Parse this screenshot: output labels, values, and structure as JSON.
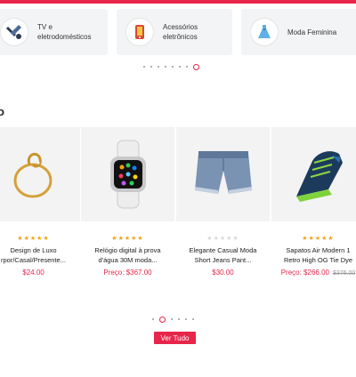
{
  "categories": [
    {
      "label_line1": "TV e",
      "label_line2": "eletrodomésticos",
      "icon": "tools-icon"
    },
    {
      "label_line1": "Acessórios",
      "label_line2": "eletrônicos",
      "icon": "phone-icon"
    },
    {
      "label_line1": "Moda Feminina",
      "label_line2": "",
      "icon": "dress-icon"
    }
  ],
  "category_pager": {
    "total": 8,
    "active_index": 7
  },
  "section": {
    "heading": "o"
  },
  "products": [
    {
      "name_line1": "Design de Luxo",
      "name_line2": "rpor/Casal/Presente...",
      "rating": 5,
      "stars": "★★★★★",
      "price_label": "",
      "price": "$24.00",
      "old_price": "",
      "image": "ring-icon"
    },
    {
      "name_line1": "Relógio digital à prova",
      "name_line2": "d'água 30M moda...",
      "rating": 5,
      "stars": "★★★★★",
      "price_label": "Preço: ",
      "price": "$367.00",
      "old_price": "",
      "image": "watch-icon"
    },
    {
      "name_line1": "Elegante Casual Moda",
      "name_line2": "Short Jeans Pant...",
      "rating": 0,
      "stars": "★★★★★",
      "price_label": "",
      "price": "$30.00",
      "old_price": "",
      "image": "shorts-icon"
    },
    {
      "name_line1": "Sapatos Air Modern 1",
      "name_line2": "Retro High OG Tie Dye",
      "rating": 5,
      "stars": "★★★★★",
      "price_label": "Preço: ",
      "price": "$266.00",
      "old_price": "$376.00",
      "image": "sneaker-icon"
    }
  ],
  "product_pager": {
    "total": 6,
    "active_index": 1
  },
  "view_all_label": "Ver Tudo",
  "colors": {
    "accent": "#e8254a",
    "star": "#f2a417"
  }
}
